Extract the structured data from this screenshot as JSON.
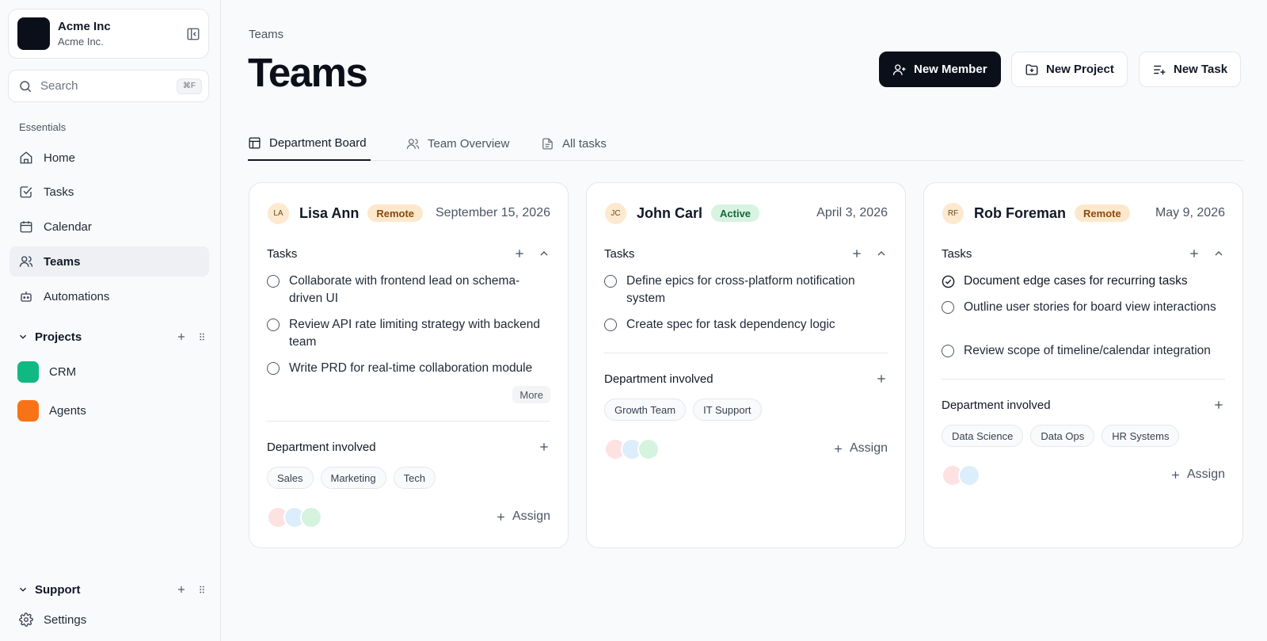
{
  "org": {
    "name": "Acme Inc",
    "sub": "Acme Inc."
  },
  "search": {
    "label": "Search",
    "shortcut": "⌘F"
  },
  "sidebar": {
    "section": "Essentials",
    "items": [
      {
        "label": "Home",
        "icon": "home-icon"
      },
      {
        "label": "Tasks",
        "icon": "check-square-icon"
      },
      {
        "label": "Calendar",
        "icon": "calendar-icon"
      },
      {
        "label": "Teams",
        "icon": "users-icon",
        "active": true
      },
      {
        "label": "Automations",
        "icon": "bot-icon"
      }
    ],
    "projects_label": "Projects",
    "projects": [
      {
        "label": "CRM",
        "color": "#10b981"
      },
      {
        "label": "Agents",
        "color": "#f97316"
      }
    ],
    "support_label": "Support",
    "settings_label": "Settings"
  },
  "header": {
    "breadcrumb": "Teams",
    "title": "Teams",
    "new_member": "New Member",
    "new_project": "New Project",
    "new_task": "New Task"
  },
  "tabs": [
    {
      "label": "Department Board",
      "active": true
    },
    {
      "label": "Team Overview"
    },
    {
      "label": "All tasks"
    }
  ],
  "labels": {
    "tasks": "Tasks",
    "departments": "Department involved",
    "more": "More",
    "assign": "Assign"
  },
  "cards": [
    {
      "initials": "LA",
      "name": "Lisa Ann",
      "status": "Remote",
      "date": "September 15, 2026",
      "tasks": [
        {
          "text": "Collaborate with frontend lead on schema-driven UI",
          "done": false
        },
        {
          "text": "Review API rate limiting strategy with backend team",
          "done": false
        },
        {
          "text": "Write PRD for real-time collaboration module",
          "done": false
        }
      ],
      "departments": [
        "Sales",
        "Marketing",
        "Tech"
      ],
      "faces": [
        "#fde2e2",
        "#dceefb",
        "#d5f3df"
      ]
    },
    {
      "initials": "JC",
      "name": "John Carl",
      "status": "Active",
      "date": "April 3, 2026",
      "tasks": [
        {
          "text": "Define epics for cross-platform notification system",
          "done": false
        },
        {
          "text": "Create spec for task dependency logic",
          "done": false
        }
      ],
      "departments": [
        "Growth Team",
        "IT Support"
      ],
      "faces": [
        "#fde2e2",
        "#dceefb",
        "#d5f3df"
      ]
    },
    {
      "initials": "RF",
      "name": "Rob Foreman",
      "status": "Remote",
      "date": "May 9, 2026",
      "tasks": [
        {
          "text": "Document edge cases for recurring tasks",
          "done": true
        },
        {
          "text": "Outline user stories for board view interactions",
          "done": false
        },
        {
          "text": "Review scope of timeline/calendar integration",
          "done": false
        }
      ],
      "departments": [
        "Data Science",
        "Data Ops",
        "HR Systems"
      ],
      "faces": [
        "#fde2e2",
        "#dceefb"
      ]
    }
  ]
}
